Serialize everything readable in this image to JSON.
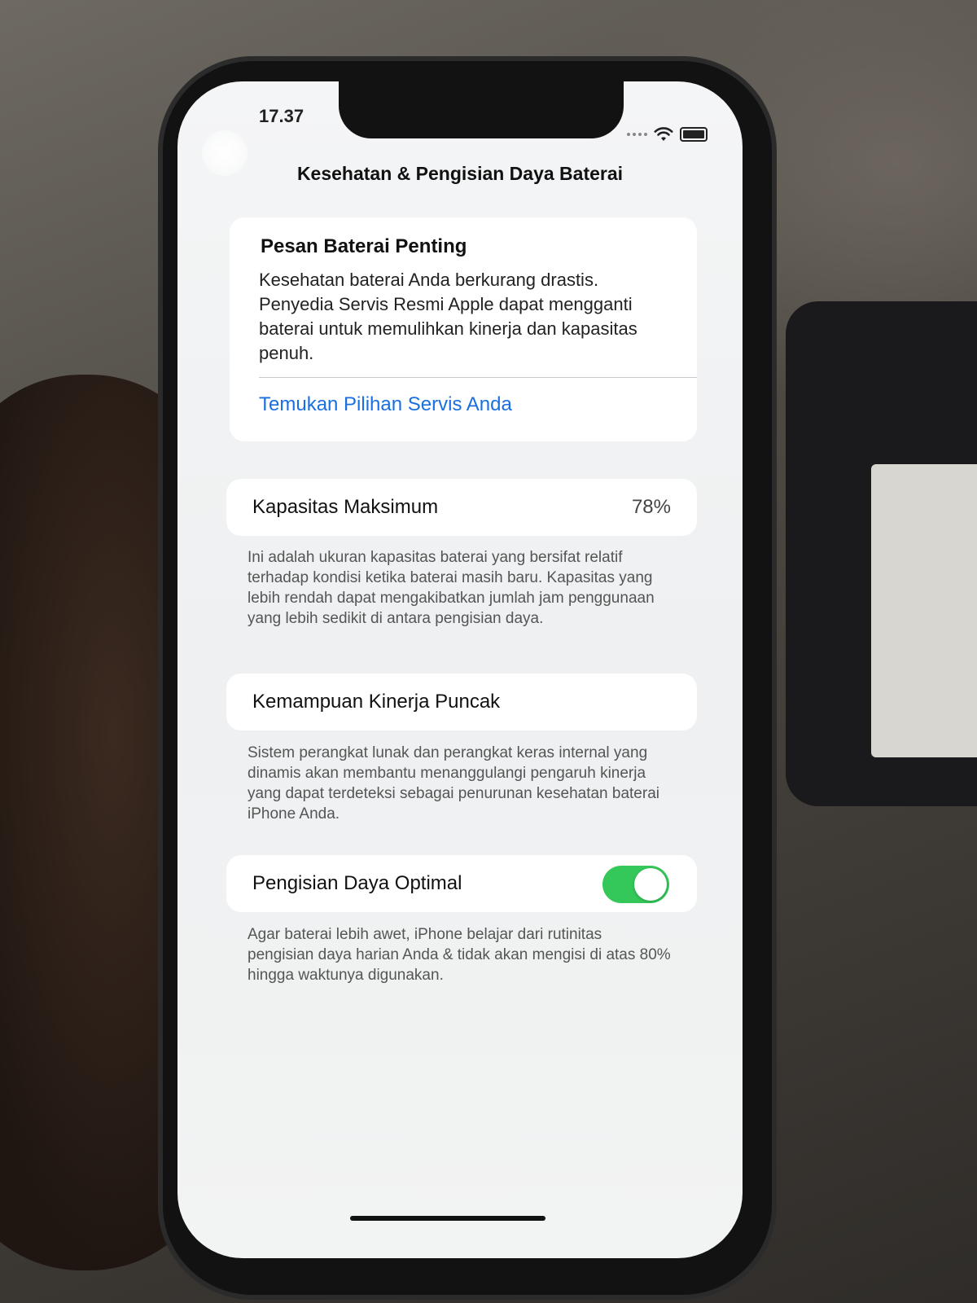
{
  "status_bar": {
    "time": "17.37",
    "icons": [
      "signal-icon",
      "wifi-icon",
      "battery-icon"
    ]
  },
  "nav": {
    "title": "Kesehatan & Pengisian Daya Baterai"
  },
  "important_message": {
    "title": "Pesan Baterai Penting",
    "body": "Kesehatan baterai Anda berkurang drastis. Penyedia Servis Resmi Apple dapat mengganti baterai untuk memulihkan kinerja dan kapasitas penuh.",
    "link": "Temukan Pilihan Servis Anda"
  },
  "max_capacity": {
    "label": "Kapasitas Maksimum",
    "value": "78%",
    "footnote": "Ini adalah ukuran kapasitas baterai yang bersifat relatif terhadap kondisi ketika baterai masih baru. Kapasitas yang lebih rendah dapat mengakibatkan jumlah jam penggunaan yang lebih sedikit di antara pengisian daya."
  },
  "peak_performance": {
    "label": "Kemampuan Kinerja Puncak",
    "footnote": "Sistem perangkat lunak dan perangkat keras internal yang dinamis akan membantu menanggulangi pengaruh kinerja yang dapat terdeteksi sebagai penurunan kesehatan baterai iPhone Anda."
  },
  "optimized_charging": {
    "label": "Pengisian Daya Optimal",
    "enabled": true,
    "toggle_color": "#34c759",
    "footnote": "Agar baterai lebih awet, iPhone belajar dari rutinitas pengisian daya harian Anda & tidak akan mengisi di atas 80% hingga waktunya digunakan."
  },
  "colors": {
    "link": "#1a6fe0",
    "screen_bg": "#f2f3f3"
  }
}
